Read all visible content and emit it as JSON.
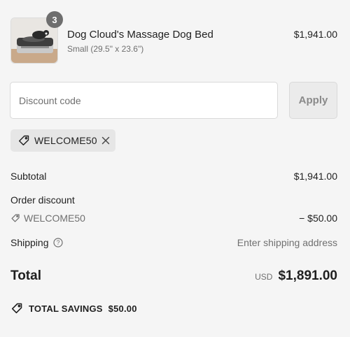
{
  "product": {
    "quantity_badge": "3",
    "name": "Dog Cloud's Massage Dog Bed",
    "variant": "Small (29.5\" x 23.6\")",
    "price": "$1,941.00"
  },
  "discount": {
    "placeholder": "Discount code",
    "value": "",
    "apply_label": "Apply",
    "applied_code": "WELCOME50"
  },
  "summary": {
    "subtotal_label": "Subtotal",
    "subtotal_value": "$1,941.00",
    "order_discount_label": "Order discount",
    "order_discount_code": "WELCOME50",
    "order_discount_value": "− $50.00",
    "shipping_label": "Shipping",
    "shipping_value": "Enter shipping address",
    "total_label": "Total",
    "total_currency": "USD",
    "total_value": "$1,891.00",
    "savings_label": "TOTAL SAVINGS",
    "savings_value": "$50.00"
  },
  "icons": {
    "tag": "tag-icon",
    "close": "close-icon",
    "info": "info-icon",
    "savings_tag": "savings-tag-icon"
  }
}
